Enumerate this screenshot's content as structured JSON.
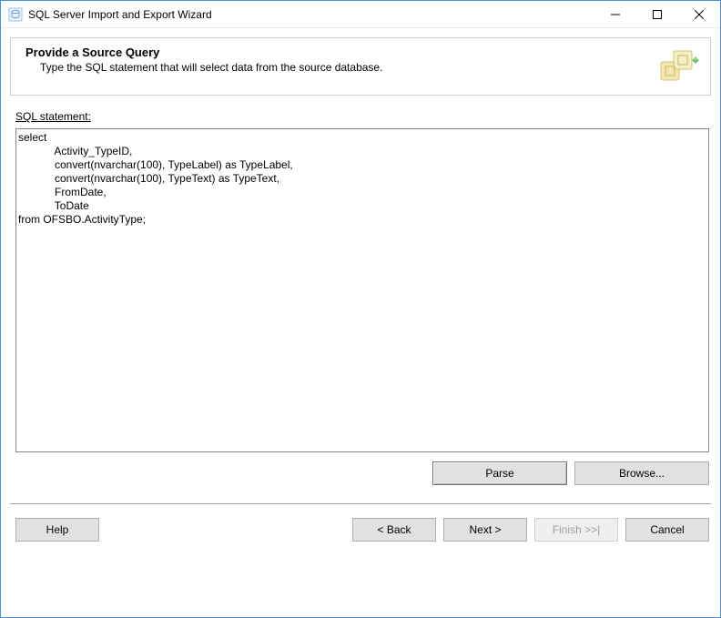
{
  "window": {
    "title": "SQL Server Import and Export Wizard"
  },
  "header": {
    "heading": "Provide a Source Query",
    "subheading": "Type the SQL statement that will select data from the source database."
  },
  "content": {
    "sql_label": "SQL statement:",
    "sql_value": "select\n            Activity_TypeID,\n            convert(nvarchar(100), TypeLabel) as TypeLabel,\n            convert(nvarchar(100), TypeText) as TypeText,\n            FromDate,\n            ToDate\nfrom OFSBO.ActivityType;",
    "parse_label": "Parse",
    "browse_label": "Browse..."
  },
  "footer": {
    "help_label": "Help",
    "back_label": "< Back",
    "next_label": "Next >",
    "finish_label": "Finish >>|",
    "cancel_label": "Cancel",
    "finish_enabled": false
  },
  "icons": {
    "app": "database-wizard-icon",
    "header": "data-transform-icon"
  }
}
